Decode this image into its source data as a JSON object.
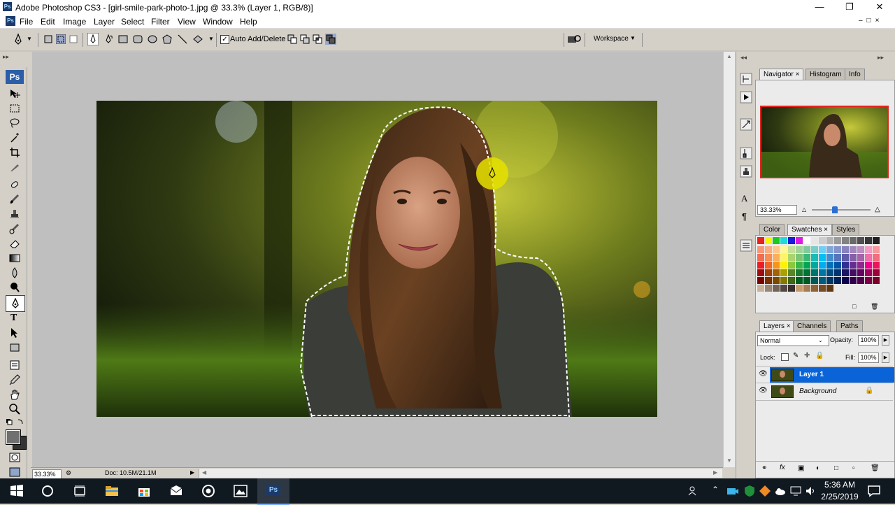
{
  "window": {
    "title": "Adobe Photoshop CS3 - [girl-smile-park-photo-1.jpg @ 33.3% (Layer 1, RGB/8)]",
    "app_icon": "Ps",
    "controls": [
      "minimize",
      "restore",
      "close"
    ]
  },
  "menubar": {
    "items": [
      "File",
      "Edit",
      "Image",
      "Layer",
      "Select",
      "Filter",
      "View",
      "Window",
      "Help"
    ]
  },
  "options_bar": {
    "auto_add_delete_label": "Auto Add/Delete",
    "auto_add_delete_checked": true,
    "workspace_label": "Workspace"
  },
  "toolbox": {
    "logo": "Ps"
  },
  "status_bar": {
    "zoom": "33.33%",
    "doc_info": "Doc: 10.5M/21.1M"
  },
  "navigator_panel": {
    "tabs": [
      "Navigator",
      "Histogram",
      "Info"
    ],
    "zoom": "33.33%"
  },
  "color_panel": {
    "tabs": [
      "Color",
      "Swatches",
      "Styles"
    ]
  },
  "layers_panel": {
    "tabs": [
      "Layers",
      "Channels",
      "Paths"
    ],
    "blend_mode": "Normal",
    "opacity_label": "Opacity:",
    "opacity": "100%",
    "lock_label": "Lock:",
    "fill_label": "Fill:",
    "fill": "100%",
    "layers": [
      {
        "name": "Layer 1",
        "selected": true,
        "visible": true,
        "locked": false
      },
      {
        "name": "Background",
        "selected": false,
        "visible": true,
        "locked": true
      }
    ]
  },
  "taskbar": {
    "time": "5:36 AM",
    "date": "2/25/2019",
    "ps_label": "Ps"
  },
  "colors": {
    "accent_selection": "#0a64d8",
    "taskbar_bg": "#101820"
  }
}
